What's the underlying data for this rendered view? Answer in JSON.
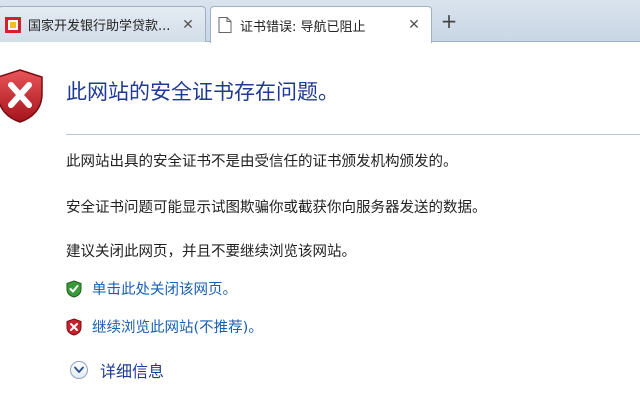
{
  "tabs": [
    {
      "title": "国家开发银行助学贷款...",
      "active": false
    },
    {
      "title": "证书错误: 导航已阻止",
      "active": true
    }
  ],
  "new_tab_symbol": "+",
  "close_symbol": "✕",
  "error": {
    "heading": "此网站的安全证书存在问题。",
    "paragraphs": [
      "此网站出具的安全证书不是由受信任的证书颁发机构颁发的。",
      "安全证书问题可能显示试图欺骗你或截获你向服务器发送的数据。",
      "建议关闭此网页，并且不要继续浏览该网站。"
    ],
    "close_link": "单击此处关闭该网页。",
    "continue_link": "继续浏览此网站(不推荐)。",
    "details_label": "详细信息"
  },
  "icons": {
    "error_shield": "red-shield-x-icon",
    "safe_shield": "green-shield-check-icon",
    "unsafe_shield": "red-shield-x-small-icon",
    "details_toggle": "chevron-down-icon"
  },
  "colors": {
    "heading": "#1f3a93",
    "link": "#1a5fb4",
    "danger": "#c8232c",
    "safe": "#2e8b2e"
  }
}
